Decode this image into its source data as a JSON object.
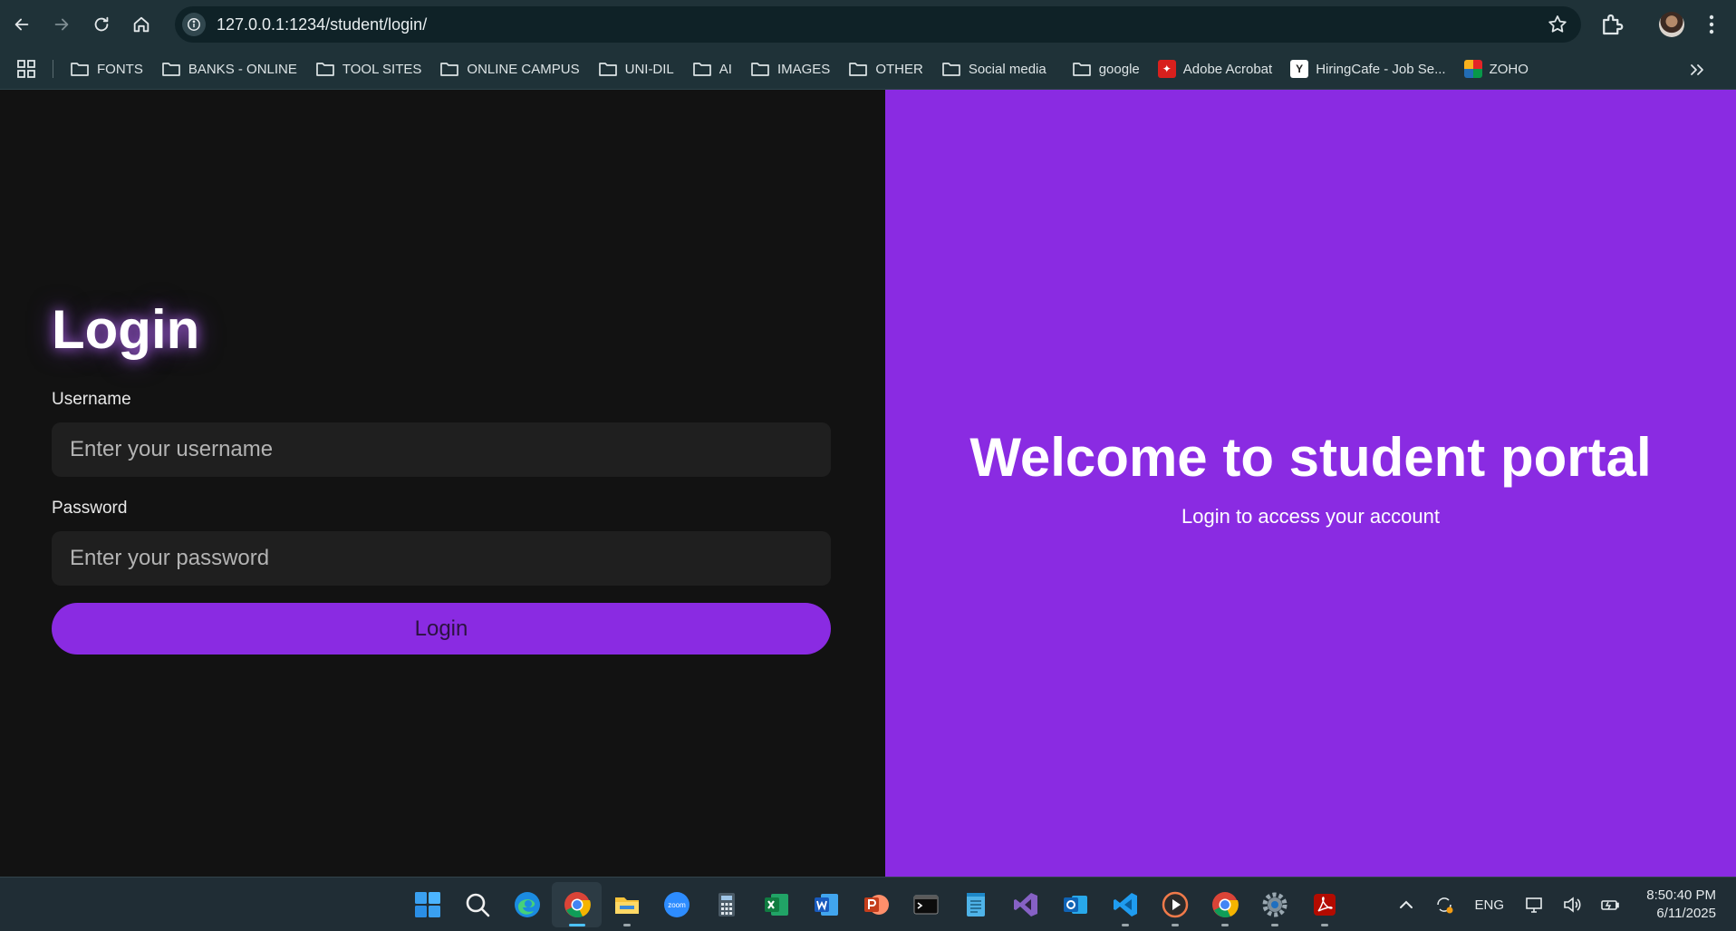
{
  "browser": {
    "url": "127.0.0.1:1234/student/login/",
    "bookmarks": [
      {
        "label": "FONTS",
        "icon": "folder-icon"
      },
      {
        "label": "BANKS - ONLINE",
        "icon": "folder-icon"
      },
      {
        "label": "TOOL SITES",
        "icon": "folder-icon"
      },
      {
        "label": "ONLINE CAMPUS",
        "icon": "folder-icon"
      },
      {
        "label": "UNI-DIL",
        "icon": "folder-icon"
      },
      {
        "label": "AI",
        "icon": "folder-icon"
      },
      {
        "label": "IMAGES",
        "icon": "folder-icon"
      },
      {
        "label": "OTHER",
        "icon": "folder-icon"
      },
      {
        "label": "Social media",
        "icon": "folder-icon"
      },
      {
        "label": "google",
        "icon": "folder-icon"
      },
      {
        "label": "Adobe Acrobat",
        "icon": "adobe-acrobat-icon"
      },
      {
        "label": "HiringCafe - Job Se...",
        "icon": "hiringcafe-icon"
      },
      {
        "label": "ZOHO",
        "icon": "zoho-icon"
      }
    ]
  },
  "login": {
    "title": "Login",
    "username_label": "Username",
    "username_placeholder": "Enter your username",
    "password_label": "Password",
    "password_placeholder": "Enter your password",
    "button_label": "Login"
  },
  "hero": {
    "title": "Welcome to student portal",
    "subtitle": "Login to access your account"
  },
  "colors": {
    "accent": "#8a2be2",
    "left_background": "#121212",
    "input_background": "#1f1f1f",
    "browser_chrome": "#1f3238",
    "taskbar": "#202d35"
  },
  "taskbar": {
    "apps": [
      "start-icon",
      "search-icon",
      "edge-icon",
      "chrome-icon",
      "file-explorer-icon",
      "zoom-icon",
      "calculator-icon",
      "excel-icon",
      "word-icon",
      "powerpoint-icon",
      "terminal-icon",
      "notepad-icon",
      "visual-studio-icon",
      "outlook-icon",
      "vscode-icon",
      "media-player-icon",
      "chrome-profile-icon",
      "settings-icon",
      "acrobat-icon"
    ],
    "zoom_label": "zoom",
    "language": "ENG",
    "time": "8:50:40 PM",
    "date": "6/11/2025"
  }
}
